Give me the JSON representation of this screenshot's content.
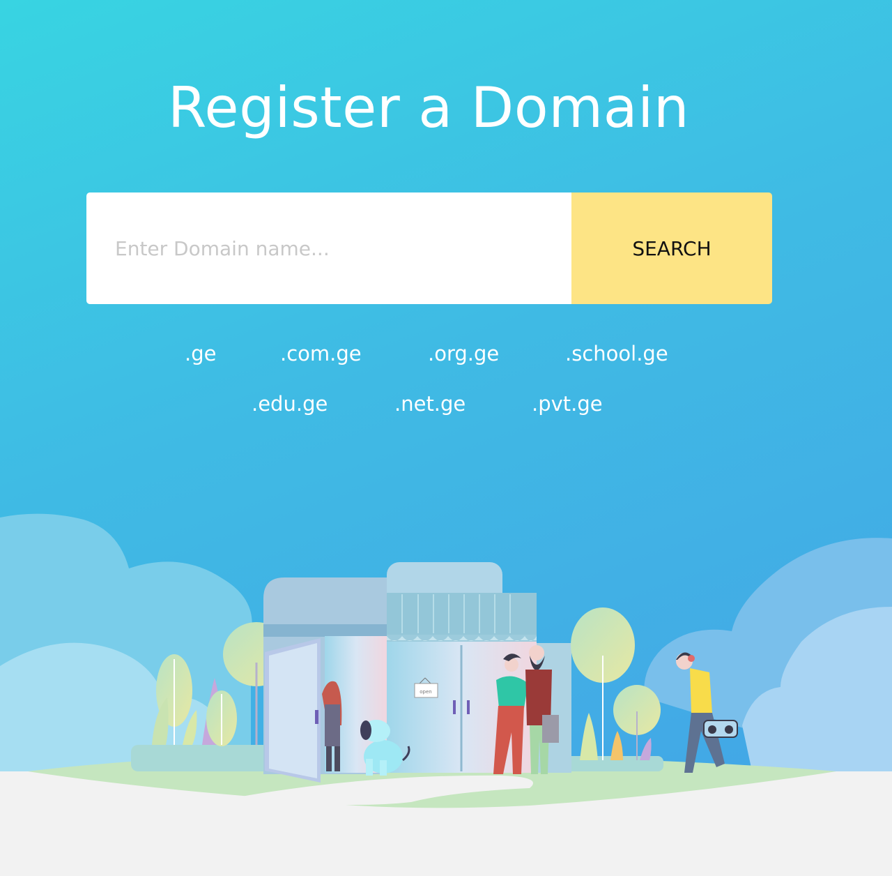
{
  "header": {
    "title": "Register a Domain"
  },
  "search": {
    "placeholder": "Enter Domain name...",
    "button_label": "SEARCH"
  },
  "tlds": [
    ".ge",
    ".com.ge",
    ".org.ge",
    ".school.ge",
    ".edu.ge",
    ".net.ge",
    ".pvt.ge"
  ],
  "illustration": {
    "sign_text": "open"
  },
  "colors": {
    "gradient_start": "#38d4e2",
    "gradient_end": "#43a6e6",
    "button": "#fde485",
    "ground": "#f2f2f2",
    "grass": "#c5e6bf"
  }
}
